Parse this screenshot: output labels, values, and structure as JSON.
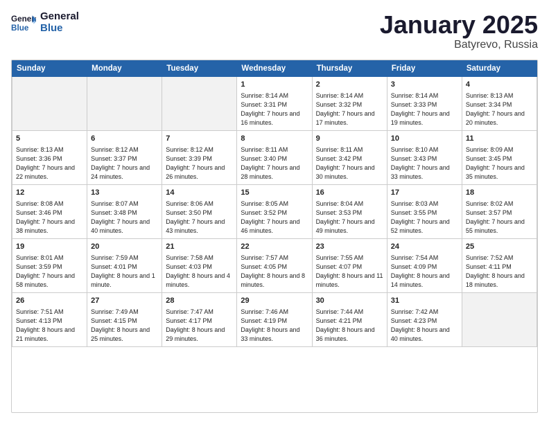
{
  "header": {
    "logo": {
      "general": "General",
      "blue": "Blue"
    },
    "title": "January 2025",
    "subtitle": "Batyrevo, Russia"
  },
  "weekdays": [
    "Sunday",
    "Monday",
    "Tuesday",
    "Wednesday",
    "Thursday",
    "Friday",
    "Saturday"
  ],
  "weeks": [
    [
      {
        "day": "",
        "sunrise": "",
        "sunset": "",
        "daylight": "",
        "empty": true
      },
      {
        "day": "",
        "sunrise": "",
        "sunset": "",
        "daylight": "",
        "empty": true
      },
      {
        "day": "",
        "sunrise": "",
        "sunset": "",
        "daylight": "",
        "empty": true
      },
      {
        "day": "1",
        "sunrise": "Sunrise: 8:14 AM",
        "sunset": "Sunset: 3:31 PM",
        "daylight": "Daylight: 7 hours and 16 minutes.",
        "empty": false
      },
      {
        "day": "2",
        "sunrise": "Sunrise: 8:14 AM",
        "sunset": "Sunset: 3:32 PM",
        "daylight": "Daylight: 7 hours and 17 minutes.",
        "empty": false
      },
      {
        "day": "3",
        "sunrise": "Sunrise: 8:14 AM",
        "sunset": "Sunset: 3:33 PM",
        "daylight": "Daylight: 7 hours and 19 minutes.",
        "empty": false
      },
      {
        "day": "4",
        "sunrise": "Sunrise: 8:13 AM",
        "sunset": "Sunset: 3:34 PM",
        "daylight": "Daylight: 7 hours and 20 minutes.",
        "empty": false
      }
    ],
    [
      {
        "day": "5",
        "sunrise": "Sunrise: 8:13 AM",
        "sunset": "Sunset: 3:36 PM",
        "daylight": "Daylight: 7 hours and 22 minutes.",
        "empty": false
      },
      {
        "day": "6",
        "sunrise": "Sunrise: 8:12 AM",
        "sunset": "Sunset: 3:37 PM",
        "daylight": "Daylight: 7 hours and 24 minutes.",
        "empty": false
      },
      {
        "day": "7",
        "sunrise": "Sunrise: 8:12 AM",
        "sunset": "Sunset: 3:39 PM",
        "daylight": "Daylight: 7 hours and 26 minutes.",
        "empty": false
      },
      {
        "day": "8",
        "sunrise": "Sunrise: 8:11 AM",
        "sunset": "Sunset: 3:40 PM",
        "daylight": "Daylight: 7 hours and 28 minutes.",
        "empty": false
      },
      {
        "day": "9",
        "sunrise": "Sunrise: 8:11 AM",
        "sunset": "Sunset: 3:42 PM",
        "daylight": "Daylight: 7 hours and 30 minutes.",
        "empty": false
      },
      {
        "day": "10",
        "sunrise": "Sunrise: 8:10 AM",
        "sunset": "Sunset: 3:43 PM",
        "daylight": "Daylight: 7 hours and 33 minutes.",
        "empty": false
      },
      {
        "day": "11",
        "sunrise": "Sunrise: 8:09 AM",
        "sunset": "Sunset: 3:45 PM",
        "daylight": "Daylight: 7 hours and 35 minutes.",
        "empty": false
      }
    ],
    [
      {
        "day": "12",
        "sunrise": "Sunrise: 8:08 AM",
        "sunset": "Sunset: 3:46 PM",
        "daylight": "Daylight: 7 hours and 38 minutes.",
        "empty": false
      },
      {
        "day": "13",
        "sunrise": "Sunrise: 8:07 AM",
        "sunset": "Sunset: 3:48 PM",
        "daylight": "Daylight: 7 hours and 40 minutes.",
        "empty": false
      },
      {
        "day": "14",
        "sunrise": "Sunrise: 8:06 AM",
        "sunset": "Sunset: 3:50 PM",
        "daylight": "Daylight: 7 hours and 43 minutes.",
        "empty": false
      },
      {
        "day": "15",
        "sunrise": "Sunrise: 8:05 AM",
        "sunset": "Sunset: 3:52 PM",
        "daylight": "Daylight: 7 hours and 46 minutes.",
        "empty": false
      },
      {
        "day": "16",
        "sunrise": "Sunrise: 8:04 AM",
        "sunset": "Sunset: 3:53 PM",
        "daylight": "Daylight: 7 hours and 49 minutes.",
        "empty": false
      },
      {
        "day": "17",
        "sunrise": "Sunrise: 8:03 AM",
        "sunset": "Sunset: 3:55 PM",
        "daylight": "Daylight: 7 hours and 52 minutes.",
        "empty": false
      },
      {
        "day": "18",
        "sunrise": "Sunrise: 8:02 AM",
        "sunset": "Sunset: 3:57 PM",
        "daylight": "Daylight: 7 hours and 55 minutes.",
        "empty": false
      }
    ],
    [
      {
        "day": "19",
        "sunrise": "Sunrise: 8:01 AM",
        "sunset": "Sunset: 3:59 PM",
        "daylight": "Daylight: 7 hours and 58 minutes.",
        "empty": false
      },
      {
        "day": "20",
        "sunrise": "Sunrise: 7:59 AM",
        "sunset": "Sunset: 4:01 PM",
        "daylight": "Daylight: 8 hours and 1 minute.",
        "empty": false
      },
      {
        "day": "21",
        "sunrise": "Sunrise: 7:58 AM",
        "sunset": "Sunset: 4:03 PM",
        "daylight": "Daylight: 8 hours and 4 minutes.",
        "empty": false
      },
      {
        "day": "22",
        "sunrise": "Sunrise: 7:57 AM",
        "sunset": "Sunset: 4:05 PM",
        "daylight": "Daylight: 8 hours and 8 minutes.",
        "empty": false
      },
      {
        "day": "23",
        "sunrise": "Sunrise: 7:55 AM",
        "sunset": "Sunset: 4:07 PM",
        "daylight": "Daylight: 8 hours and 11 minutes.",
        "empty": false
      },
      {
        "day": "24",
        "sunrise": "Sunrise: 7:54 AM",
        "sunset": "Sunset: 4:09 PM",
        "daylight": "Daylight: 8 hours and 14 minutes.",
        "empty": false
      },
      {
        "day": "25",
        "sunrise": "Sunrise: 7:52 AM",
        "sunset": "Sunset: 4:11 PM",
        "daylight": "Daylight: 8 hours and 18 minutes.",
        "empty": false
      }
    ],
    [
      {
        "day": "26",
        "sunrise": "Sunrise: 7:51 AM",
        "sunset": "Sunset: 4:13 PM",
        "daylight": "Daylight: 8 hours and 21 minutes.",
        "empty": false
      },
      {
        "day": "27",
        "sunrise": "Sunrise: 7:49 AM",
        "sunset": "Sunset: 4:15 PM",
        "daylight": "Daylight: 8 hours and 25 minutes.",
        "empty": false
      },
      {
        "day": "28",
        "sunrise": "Sunrise: 7:47 AM",
        "sunset": "Sunset: 4:17 PM",
        "daylight": "Daylight: 8 hours and 29 minutes.",
        "empty": false
      },
      {
        "day": "29",
        "sunrise": "Sunrise: 7:46 AM",
        "sunset": "Sunset: 4:19 PM",
        "daylight": "Daylight: 8 hours and 33 minutes.",
        "empty": false
      },
      {
        "day": "30",
        "sunrise": "Sunrise: 7:44 AM",
        "sunset": "Sunset: 4:21 PM",
        "daylight": "Daylight: 8 hours and 36 minutes.",
        "empty": false
      },
      {
        "day": "31",
        "sunrise": "Sunrise: 7:42 AM",
        "sunset": "Sunset: 4:23 PM",
        "daylight": "Daylight: 8 hours and 40 minutes.",
        "empty": false
      },
      {
        "day": "",
        "sunrise": "",
        "sunset": "",
        "daylight": "",
        "empty": true
      }
    ]
  ]
}
